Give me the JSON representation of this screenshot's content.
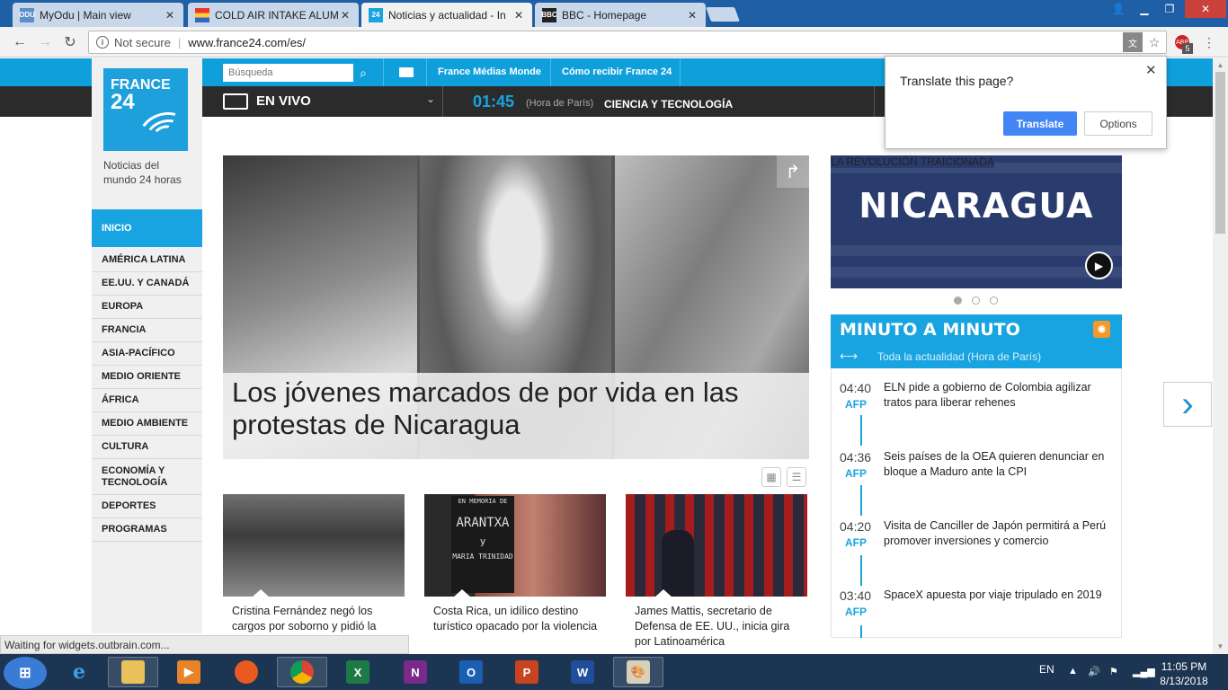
{
  "browser": {
    "tabs": [
      {
        "label": "MyOdu | Main view",
        "favicon": "odu"
      },
      {
        "label": "COLD AIR INTAKE ALUMI",
        "favicon": "store"
      },
      {
        "label": "Noticias y actualidad - In",
        "favicon": "france24"
      },
      {
        "label": "BBC - Homepage",
        "favicon": "bbc"
      }
    ],
    "address": {
      "security": "Not secure",
      "url": "www.france24.com/es/"
    },
    "extension_badge": "5",
    "status": "Waiting for widgets.outbrain.com..."
  },
  "translate_bubble": {
    "question": "Translate this page?",
    "translate_label": "Translate",
    "options_label": "Options"
  },
  "site": {
    "search_placeholder": "Búsqueda",
    "top_links": [
      "France Médias Monde",
      "Cómo recibir France 24"
    ],
    "live_label": "EN VIVO",
    "live_time": "01:45",
    "live_time_note": "(Hora de París)",
    "live_program": "CIENCIA Y TECNOLOGÍA",
    "logo": {
      "line1": "FRANCE",
      "line2": "24"
    },
    "tagline": "Noticias del mundo 24 horas",
    "nav": {
      "home": "INICIO",
      "items": [
        "AMÉRICA LATINA",
        "EE.UU. Y CANADÁ",
        "EUROPA",
        "FRANCIA",
        "ASIA-PACÍFICO",
        "MEDIO ORIENTE",
        "ÁFRICA",
        "MEDIO AMBIENTE",
        "CULTURA",
        "ECONOMÍA Y TECNOLOGÍA",
        "DEPORTES",
        "PROGRAMAS"
      ]
    },
    "hero": {
      "headline": "Los jóvenes marcados de por vida en las protestas de Nicaragua"
    },
    "cards": [
      {
        "title": "Cristina Fernández negó los cargos por soborno y pidió la"
      },
      {
        "title": "Costa Rica, un idílico destino turístico opacado por la violencia",
        "image_text": [
          "EN MEMORIA DE",
          "ARANTXA",
          "y",
          "MARIA TRINIDAD"
        ]
      },
      {
        "title": "James Mattis, secretario de Defensa de EE. UU., inicia gira por Latinoamérica"
      }
    ],
    "promo": {
      "title": "NICARAGUA",
      "subtitle": "LA REVOLUCIÓN TRAICIONADA"
    },
    "minuto": {
      "title": "MINUTO A MINUTO",
      "subtitle": "Toda la actualidad (Hora de París)",
      "items": [
        {
          "time": "04:40",
          "source": "AFP",
          "text": "ELN pide a gobierno de Colombia agilizar tratos para liberar rehenes"
        },
        {
          "time": "04:36",
          "source": "AFP",
          "text": "Seis países de la OEA quieren denunciar en bloque a Maduro ante la CPI"
        },
        {
          "time": "04:20",
          "source": "AFP",
          "text": "Visita de Canciller de Japón permitirá a Perú promover inversiones y comercio"
        },
        {
          "time": "03:40",
          "source": "AFP",
          "text": "SpaceX apuesta por viaje tripulado en 2019"
        }
      ]
    }
  },
  "taskbar": {
    "language": "EN",
    "time": "11:05 PM",
    "date": "8/13/2018"
  },
  "colors": {
    "accent": "#18a4e0",
    "dark_bar": "#2b2b2b",
    "taskbar": "#1c3553"
  }
}
